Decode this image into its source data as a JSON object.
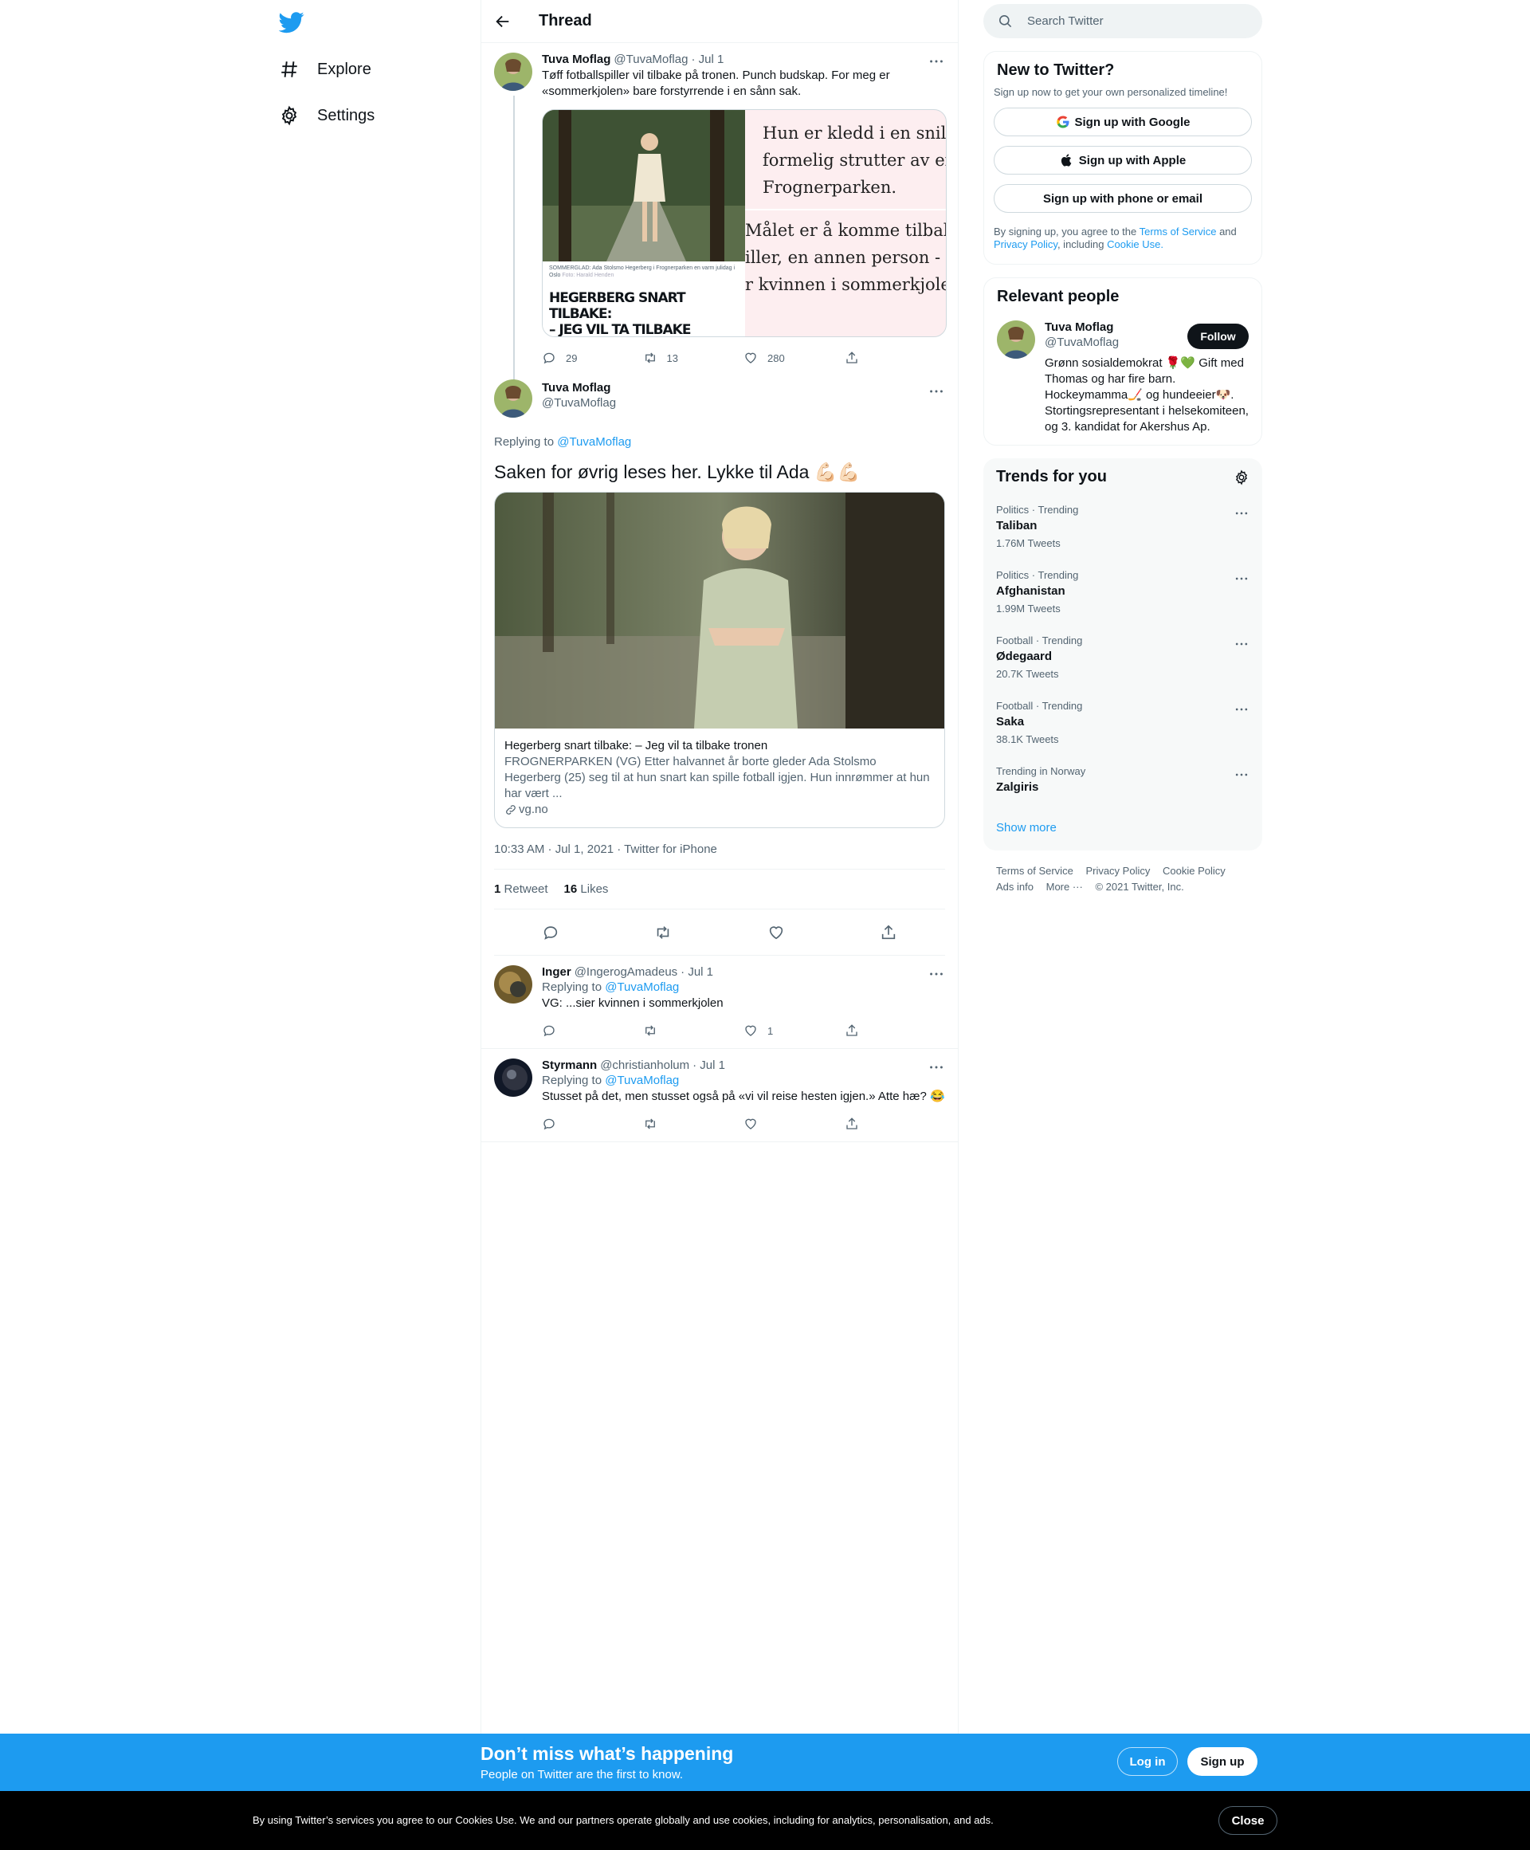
{
  "nav": {
    "explore": "Explore",
    "settings": "Settings"
  },
  "header": {
    "title": "Thread"
  },
  "thread": {
    "first_tweet": {
      "name": "Tuva Moflag",
      "handle": "@TuvaMoflag",
      "date": "· Jul 1",
      "text": "Tøff fotballspiller vil tilbake på tronen. Punch budskap. For meg er «sommerkjolen» bare forstyrrende i en sånn sak.",
      "image_caption": "SOMMERGLAD: Ada Stolsmo Hegerberg i Frognerparken en varm julidag i Oslo",
      "image_credit": "Foto: Harald Henden",
      "image_headline_1": "HEGERBERG SNART TILBAKE:",
      "image_headline_2": "– JEG VIL TA TILBAKE TRONEN",
      "quote_1": "Hun er kledd i en snill",
      "quote_2": "formelig strutter av en",
      "quote_3": "Frognerparken.",
      "quote_4": "Målet er å komme tilbake",
      "quote_5": "iller, en annen person - i",
      "quote_6": "r kvinnen i sommerkjole",
      "replies": "29",
      "retweets": "13",
      "likes": "280"
    },
    "main_tweet": {
      "name": "Tuva Moflag",
      "handle": "@TuvaMoflag",
      "replying_label": "Replying to",
      "replying_to": "@TuvaMoflag",
      "text": "Saken for øvrig leses her. Lykke til Ada 💪🏻💪🏻",
      "link_title": "Hegerberg snart tilbake: – Jeg vil ta tilbake tronen",
      "link_desc": "FROGNERPARKEN (VG) Etter halvannet år borte gleder Ada Stolsmo Hegerberg (25) seg til at hun snart kan spille fotball igjen. Hun innrømmer at hun har vært ...",
      "link_domain": "vg.no",
      "timestamp": "10:33 AM · Jul 1, 2021 · Twitter for iPhone",
      "retweet_count": "1",
      "retweet_label": "Retweet",
      "like_count": "16",
      "like_label": "Likes"
    },
    "replies": [
      {
        "name": "Inger",
        "handle": "@IngerogAmadeus",
        "date": "· Jul 1",
        "replying_label": "Replying to",
        "replying_to": "@TuvaMoflag",
        "text": "VG: ...sier kvinnen i sommerkjolen",
        "likes": "1"
      },
      {
        "name": "Styrmann",
        "handle": "@christianholum",
        "date": "· Jul 1",
        "replying_label": "Replying to",
        "replying_to": "@TuvaMoflag",
        "text": "Stusset på det, men stusset også på «vi vil reise hesten igjen.» Atte hæ? 😂",
        "likes": ""
      }
    ]
  },
  "sidebar": {
    "search_placeholder": "Search Twitter",
    "new_to_twitter": {
      "title": "New to Twitter?",
      "subtitle": "Sign up now to get your own personalized timeline!",
      "google": "Sign up with Google",
      "apple": "Sign up with Apple",
      "phone": "Sign up with phone or email",
      "terms_1": "By signing up, you agree to the",
      "terms_link_1": "Terms of Service",
      "terms_2": "and",
      "terms_link_2": "Privacy Policy",
      "terms_3": ", including",
      "terms_link_3": "Cookie Use."
    },
    "relevant_people": {
      "title": "Relevant people",
      "name": "Tuva Moflag",
      "handle": "@TuvaMoflag",
      "follow": "Follow",
      "bio": "Grønn sosialdemokrat 🌹💚 Gift med Thomas og har fire barn. Hockeymamma🏒 og hundeeier🐶. Stortingsrepresentant i helsekomiteen, og 3. kandidat for Akershus Ap."
    },
    "trends": {
      "title": "Trends for you",
      "items": [
        {
          "category": "Politics · Trending",
          "name": "Taliban",
          "count": "1.76M Tweets"
        },
        {
          "category": "Politics · Trending",
          "name": "Afghanistan",
          "count": "1.99M Tweets"
        },
        {
          "category": "Football · Trending",
          "name": "Ødegaard",
          "count": "20.7K Tweets"
        },
        {
          "category": "Football · Trending",
          "name": "Saka",
          "count": "38.1K Tweets"
        },
        {
          "category": "Trending in Norway",
          "name": "Zalgiris",
          "count": ""
        }
      ],
      "show_more": "Show more"
    },
    "footer": {
      "terms": "Terms of Service",
      "privacy": "Privacy Policy",
      "cookie": "Cookie Policy",
      "ads": "Ads info",
      "more": "More ···",
      "copyright": "© 2021 Twitter, Inc."
    }
  },
  "bottom_bar": {
    "title": "Don’t miss what’s happening",
    "subtitle": "People on Twitter are the first to know.",
    "login": "Log in",
    "signup": "Sign up"
  },
  "cookie_bar": {
    "text": "By using Twitter’s services you agree to our Cookies Use. We and our partners operate globally and use cookies, including for analytics, personalisation, and ads.",
    "close": "Close"
  },
  "colors": {
    "accent": "#1d9bf0",
    "text": "#0f1419",
    "secondary": "#536471"
  }
}
